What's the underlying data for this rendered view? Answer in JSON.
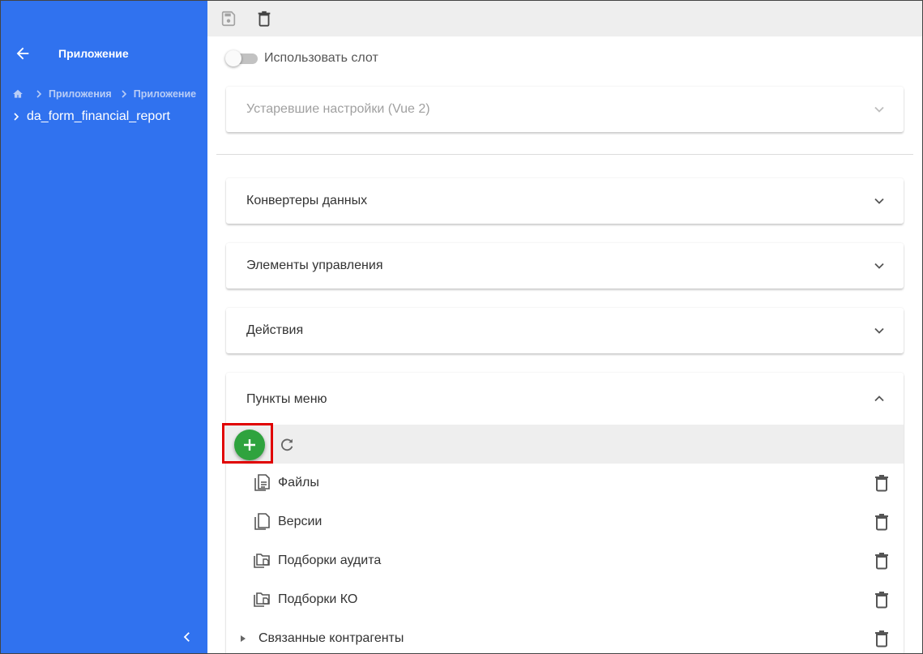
{
  "sidebar": {
    "title": "Приложение",
    "breadcrumbs": [
      "Приложения",
      "Приложение"
    ],
    "tree_item": "da_form_financial_report"
  },
  "toolbar": {
    "icons": [
      "save-icon",
      "delete-icon"
    ]
  },
  "main": {
    "slot_toggle_label": "Использовать слот",
    "slot_toggle_on": false,
    "panels": [
      {
        "title": "Устаревшие настройки (Vue 2)",
        "expanded": false,
        "disabled": true
      },
      {
        "title": "Конвертеры данных",
        "expanded": false
      },
      {
        "title": "Элементы управления",
        "expanded": false
      },
      {
        "title": "Действия",
        "expanded": false
      },
      {
        "title": "Пункты меню",
        "expanded": true
      }
    ],
    "menu_items": [
      {
        "label": "Файлы",
        "icon": "document-text-icon"
      },
      {
        "label": "Версии",
        "icon": "document-copy-icon"
      },
      {
        "label": "Подборки аудита",
        "icon": "folder-copy-icon"
      },
      {
        "label": "Подборки КО",
        "icon": "folder-copy-icon"
      },
      {
        "label": "Связанные контрагенты",
        "icon": "caret-right-icon"
      }
    ]
  },
  "colors": {
    "sidebar_bg": "#3072ef",
    "fab_bg": "#2fa33e",
    "highlight_border": "#e00000"
  }
}
